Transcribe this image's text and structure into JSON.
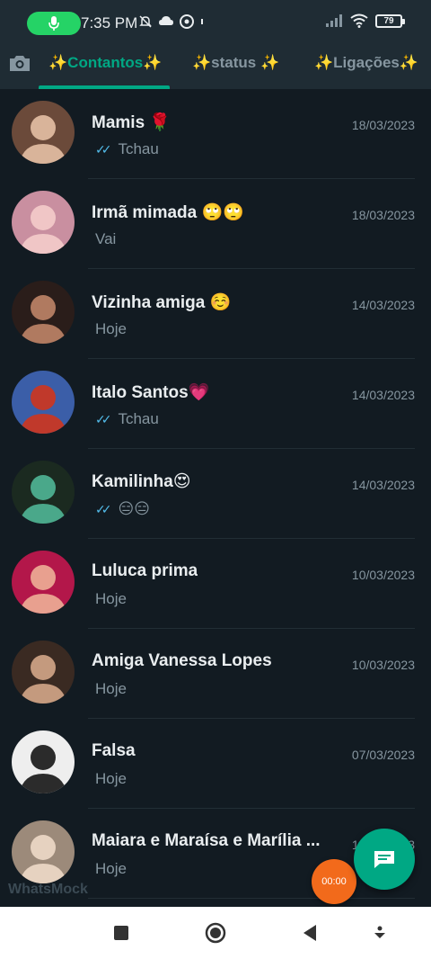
{
  "status_bar": {
    "time": "7:35 PM",
    "battery": "79",
    "mic_pill_color": "#25d366"
  },
  "tabs": [
    {
      "label": "✨Contantos✨",
      "active": true
    },
    {
      "label": "✨status ✨",
      "active": false
    },
    {
      "label": "✨Ligações✨",
      "active": false
    }
  ],
  "chats": [
    {
      "name": "Mamis 🌹",
      "date": "18/03/2023",
      "message": "Tchau",
      "read_ticks": true,
      "avatar": "avatar-woman"
    },
    {
      "name": "Irmã mimada 🙄🙄",
      "date": "18/03/2023",
      "message": "Vai",
      "read_ticks": false,
      "avatar": "avatar-woman"
    },
    {
      "name": "Vizinha amiga ☺️",
      "date": "14/03/2023",
      "message": "Hoje",
      "read_ticks": false,
      "avatar": "avatar-woman"
    },
    {
      "name": "Italo Santos💗",
      "date": "14/03/2023",
      "message": "Tchau",
      "read_ticks": true,
      "avatar": "avatar-group"
    },
    {
      "name": "Kamilinha😍",
      "date": "14/03/2023",
      "message": "😑😑",
      "read_ticks": true,
      "avatar": "avatar-woman"
    },
    {
      "name": "Luluca prima",
      "date": "10/03/2023",
      "message": "Hoje",
      "read_ticks": false,
      "avatar": "avatar-woman"
    },
    {
      "name": "Amiga Vanessa Lopes",
      "date": "10/03/2023",
      "message": "Hoje",
      "read_ticks": false,
      "avatar": "avatar-woman"
    },
    {
      "name": "Falsa",
      "date": "07/03/2023",
      "message": "Hoje",
      "read_ticks": false,
      "avatar": "avatar-woman"
    },
    {
      "name": "Maiara e Maraísa e Marília ...",
      "date": "10/03/2023",
      "message": "Hoje",
      "read_ticks": false,
      "avatar": "avatar-woman"
    }
  ],
  "watermark": "WhatsMock",
  "timer": "00:00",
  "colors": {
    "accent": "#00a884",
    "background": "#121b22",
    "header": "#1f2c34",
    "ticks": "#53bdeb",
    "timer": "#f26a1b"
  },
  "icons": {
    "camera": "camera-icon",
    "new_chat": "message-icon",
    "nav_recents": "square-icon",
    "nav_home": "circle-icon",
    "nav_back": "triangle-back-icon",
    "nav_extra": "down-arrow-icon"
  }
}
